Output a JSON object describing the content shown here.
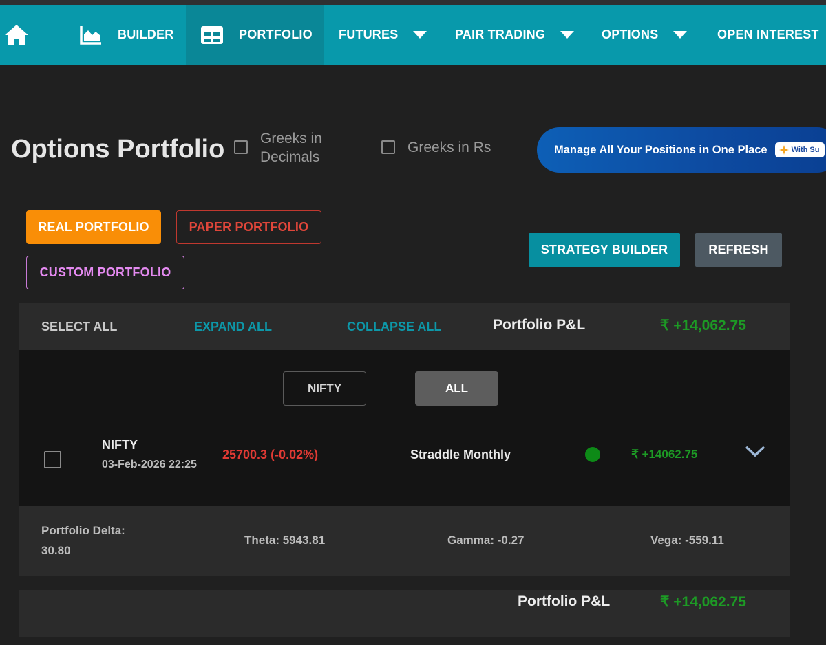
{
  "nav": {
    "items": [
      {
        "label": "BUILDER"
      },
      {
        "label": "PORTFOLIO"
      },
      {
        "label": "FUTURES"
      },
      {
        "label": "PAIR TRADING"
      },
      {
        "label": "OPTIONS"
      },
      {
        "label": "OPEN INTEREST"
      }
    ]
  },
  "header": {
    "title": "Options Portfolio",
    "greeks_decimals_label": "Greeks in Decimals",
    "greeks_rs_label": "Greeks in Rs"
  },
  "banner": {
    "text": "Manage All Your Positions in One Place",
    "pill": "With Su"
  },
  "buttons": {
    "real": "REAL PORTFOLIO",
    "paper": "PAPER PORTFOLIO",
    "custom": "CUSTOM PORTFOLIO",
    "strategy_builder": "STRATEGY BUILDER",
    "refresh": "REFRESH"
  },
  "toolbar": {
    "select_all": "SELECT ALL",
    "expand_all": "EXPAND ALL",
    "collapse_all": "COLLAPSE ALL",
    "pl_label": "Portfolio P&L",
    "pl_value": "₹ +14,062.75"
  },
  "filters": {
    "nifty": "NIFTY",
    "all": "ALL"
  },
  "position": {
    "symbol": "NIFTY",
    "datetime": "03-Feb-2026 22:25",
    "price": "25700.3 (-0.02%)",
    "strategy": "Straddle Monthly",
    "pl": "₹ +14062.75"
  },
  "greeks": {
    "delta_label": "Portfolio Delta:",
    "delta_value": "30.80",
    "theta": "Theta: 5943.81",
    "gamma": "Gamma: -0.27",
    "vega": "Vega: -559.11"
  },
  "footer": {
    "pl_label": "Portfolio P&L",
    "pl_value": "₹ +14,062.75"
  },
  "colors": {
    "nav_bg": "#0899ab",
    "accent_orange": "#f98e07",
    "profit_green": "#1d9a25",
    "loss_red": "#e13a34"
  }
}
